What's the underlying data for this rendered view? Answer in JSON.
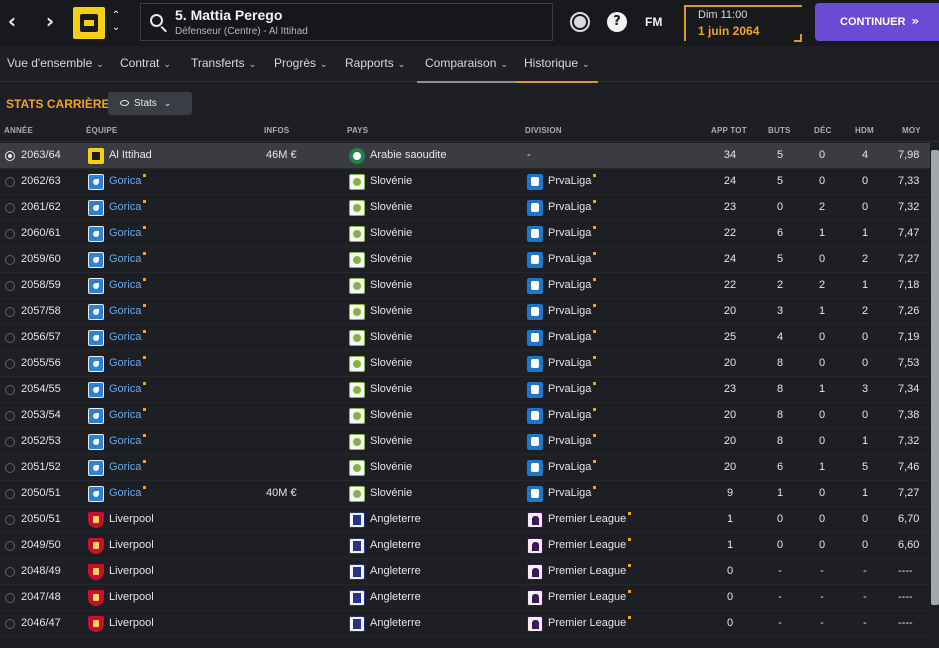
{
  "header": {
    "player_name": "5. Mattia Perego",
    "player_subtitle": "Défenseur (Centre) - Al Ittihad",
    "fm_label": "FM",
    "date_line1": "Dim 11:00",
    "date_line2": "1 juin 2064",
    "continue_label": "CONTINUER",
    "colors": {
      "accent": "#f0a521",
      "continue": "#6b4ad6"
    },
    "icons": [
      "back-icon",
      "forward-icon",
      "club-badge-icon",
      "search-icon",
      "globe-icon",
      "help-icon"
    ]
  },
  "tabs": [
    {
      "label": "Vue d'ensemble"
    },
    {
      "label": "Contrat"
    },
    {
      "label": "Transferts"
    },
    {
      "label": "Progrès"
    },
    {
      "label": "Rapports"
    },
    {
      "label": "Comparaison"
    },
    {
      "label": "Historique"
    }
  ],
  "section": {
    "title": "STATS CARRIÈRE",
    "stats_button": "Stats"
  },
  "table": {
    "columns": {
      "annee": "ANNÉE",
      "equipe": "ÉQUIPE",
      "infos": "INFOS",
      "pays": "PAYS",
      "division": "DIVISION",
      "app": "APP TOT",
      "buts": "BUTS",
      "dec": "DÉC",
      "hdm": "HDM",
      "moy": "MOY"
    },
    "rows": [
      {
        "year": "2063/64",
        "team": "Al Ittihad",
        "club": "alittihad",
        "info": "46M €",
        "country": "Arabie saoudite",
        "flag": "saudi",
        "division": "-",
        "comp": "",
        "app": "34",
        "goals": "5",
        "assists": "0",
        "pom": "4",
        "avg": "7,98",
        "link": false,
        "selected": true
      },
      {
        "year": "2062/63",
        "team": "Gorica",
        "club": "gorica",
        "info": "",
        "country": "Slovénie",
        "flag": "slovenia",
        "division": "PrvaLiga",
        "comp": "prvaliga",
        "app": "24",
        "goals": "5",
        "assists": "0",
        "pom": "0",
        "avg": "7,33",
        "link": true
      },
      {
        "year": "2061/62",
        "team": "Gorica",
        "club": "gorica",
        "info": "",
        "country": "Slovénie",
        "flag": "slovenia",
        "division": "PrvaLiga",
        "comp": "prvaliga",
        "app": "23",
        "goals": "0",
        "assists": "2",
        "pom": "0",
        "avg": "7,32",
        "link": true
      },
      {
        "year": "2060/61",
        "team": "Gorica",
        "club": "gorica",
        "info": "",
        "country": "Slovénie",
        "flag": "slovenia",
        "division": "PrvaLiga",
        "comp": "prvaliga",
        "app": "22",
        "goals": "6",
        "assists": "1",
        "pom": "1",
        "avg": "7,47",
        "link": true
      },
      {
        "year": "2059/60",
        "team": "Gorica",
        "club": "gorica",
        "info": "",
        "country": "Slovénie",
        "flag": "slovenia",
        "division": "PrvaLiga",
        "comp": "prvaliga",
        "app": "24",
        "goals": "5",
        "assists": "0",
        "pom": "2",
        "avg": "7,27",
        "link": true
      },
      {
        "year": "2058/59",
        "team": "Gorica",
        "club": "gorica",
        "info": "",
        "country": "Slovénie",
        "flag": "slovenia",
        "division": "PrvaLiga",
        "comp": "prvaliga",
        "app": "22",
        "goals": "2",
        "assists": "2",
        "pom": "1",
        "avg": "7,18",
        "link": true
      },
      {
        "year": "2057/58",
        "team": "Gorica",
        "club": "gorica",
        "info": "",
        "country": "Slovénie",
        "flag": "slovenia",
        "division": "PrvaLiga",
        "comp": "prvaliga",
        "app": "20",
        "goals": "3",
        "assists": "1",
        "pom": "2",
        "avg": "7,26",
        "link": true
      },
      {
        "year": "2056/57",
        "team": "Gorica",
        "club": "gorica",
        "info": "",
        "country": "Slovénie",
        "flag": "slovenia",
        "division": "PrvaLiga",
        "comp": "prvaliga",
        "app": "25",
        "goals": "4",
        "assists": "0",
        "pom": "0",
        "avg": "7,19",
        "link": true
      },
      {
        "year": "2055/56",
        "team": "Gorica",
        "club": "gorica",
        "info": "",
        "country": "Slovénie",
        "flag": "slovenia",
        "division": "PrvaLiga",
        "comp": "prvaliga",
        "app": "20",
        "goals": "8",
        "assists": "0",
        "pom": "0",
        "avg": "7,53",
        "link": true
      },
      {
        "year": "2054/55",
        "team": "Gorica",
        "club": "gorica",
        "info": "",
        "country": "Slovénie",
        "flag": "slovenia",
        "division": "PrvaLiga",
        "comp": "prvaliga",
        "app": "23",
        "goals": "8",
        "assists": "1",
        "pom": "3",
        "avg": "7,34",
        "link": true
      },
      {
        "year": "2053/54",
        "team": "Gorica",
        "club": "gorica",
        "info": "",
        "country": "Slovénie",
        "flag": "slovenia",
        "division": "PrvaLiga",
        "comp": "prvaliga",
        "app": "20",
        "goals": "8",
        "assists": "0",
        "pom": "0",
        "avg": "7,38",
        "link": true
      },
      {
        "year": "2052/53",
        "team": "Gorica",
        "club": "gorica",
        "info": "",
        "country": "Slovénie",
        "flag": "slovenia",
        "division": "PrvaLiga",
        "comp": "prvaliga",
        "app": "20",
        "goals": "8",
        "assists": "0",
        "pom": "1",
        "avg": "7,32",
        "link": true
      },
      {
        "year": "2051/52",
        "team": "Gorica",
        "club": "gorica",
        "info": "",
        "country": "Slovénie",
        "flag": "slovenia",
        "division": "PrvaLiga",
        "comp": "prvaliga",
        "app": "20",
        "goals": "6",
        "assists": "1",
        "pom": "5",
        "avg": "7,46",
        "link": true
      },
      {
        "year": "2050/51",
        "team": "Gorica",
        "club": "gorica",
        "info": "40M €",
        "country": "Slovénie",
        "flag": "slovenia",
        "division": "PrvaLiga",
        "comp": "prvaliga",
        "app": "9",
        "goals": "1",
        "assists": "0",
        "pom": "1",
        "avg": "7,27",
        "link": true
      },
      {
        "year": "2050/51",
        "team": "Liverpool",
        "club": "liverpool",
        "info": "",
        "country": "Angleterre",
        "flag": "england",
        "division": "Premier League",
        "comp": "premier",
        "app": "1",
        "goals": "0",
        "assists": "0",
        "pom": "0",
        "avg": "6,70",
        "link": false
      },
      {
        "year": "2049/50",
        "team": "Liverpool",
        "club": "liverpool",
        "info": "",
        "country": "Angleterre",
        "flag": "england",
        "division": "Premier League",
        "comp": "premier",
        "app": "1",
        "goals": "0",
        "assists": "0",
        "pom": "0",
        "avg": "6,60",
        "link": false
      },
      {
        "year": "2048/49",
        "team": "Liverpool",
        "club": "liverpool",
        "info": "",
        "country": "Angleterre",
        "flag": "england",
        "division": "Premier League",
        "comp": "premier",
        "app": "0",
        "goals": "-",
        "assists": "-",
        "pom": "-",
        "avg": "----",
        "link": false
      },
      {
        "year": "2047/48",
        "team": "Liverpool",
        "club": "liverpool",
        "info": "",
        "country": "Angleterre",
        "flag": "england",
        "division": "Premier League",
        "comp": "premier",
        "app": "0",
        "goals": "-",
        "assists": "-",
        "pom": "-",
        "avg": "----",
        "link": false
      },
      {
        "year": "2046/47",
        "team": "Liverpool",
        "club": "liverpool",
        "info": "",
        "country": "Angleterre",
        "flag": "england",
        "division": "Premier League",
        "comp": "premier",
        "app": "0",
        "goals": "-",
        "assists": "-",
        "pom": "-",
        "avg": "----",
        "link": false
      }
    ]
  }
}
